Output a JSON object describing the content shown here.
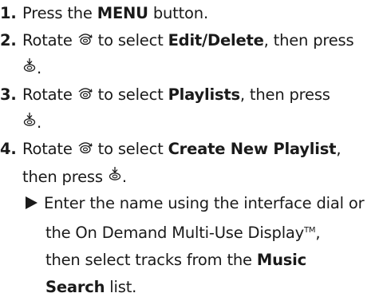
{
  "steps": [
    {
      "num": "1.",
      "pre": "Press the ",
      "bold": "MENU",
      "post": " button."
    },
    {
      "num": "2.",
      "pre": "Rotate ",
      "mid": " to select ",
      "bold": "Edit/Delete",
      "post": ", then press",
      "end": "."
    },
    {
      "num": "3.",
      "pre": "Rotate ",
      "mid": " to select ",
      "bold": "Playlists",
      "post": ", then press",
      "end": "."
    },
    {
      "num": "4.",
      "pre": "Rotate ",
      "mid": " to select ",
      "bold": "Create New Playlist",
      "post": ",",
      "line2_pre": "then press ",
      "end": "."
    }
  ],
  "note": {
    "line1": "Enter the name using the interface dial or",
    "line2": "the On Demand Multi-Use Display",
    "tm": "TM",
    "line2_end": ",",
    "line3_pre": "then select tracks from the ",
    "line3_bold": "Music",
    "line4_bold": "Search",
    "line4_post": " list."
  },
  "icons": {
    "rotate": "rotate-dial-icon",
    "press": "press-dial-icon"
  }
}
